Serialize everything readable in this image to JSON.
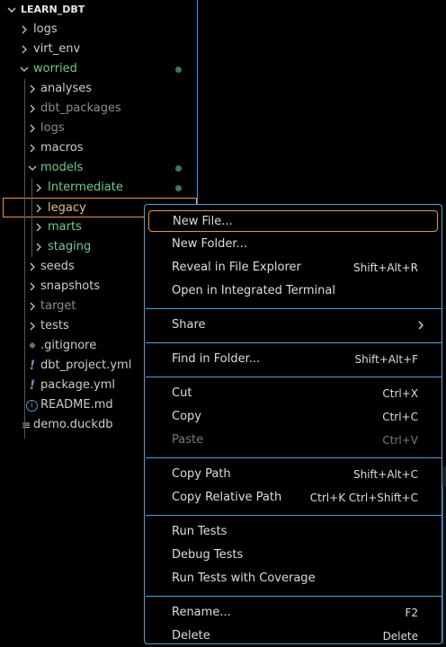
{
  "explorer": {
    "title": "LEARN_DBT",
    "tree": [
      {
        "label": "logs",
        "type": "folder",
        "depth": 0,
        "expanded": false,
        "color": "#cccccc",
        "modified": false
      },
      {
        "label": "virt_env",
        "type": "folder",
        "depth": 0,
        "expanded": false,
        "color": "#cccccc",
        "modified": false
      },
      {
        "label": "worried",
        "type": "folder",
        "depth": 0,
        "expanded": true,
        "color": "#73c991",
        "modified": true
      },
      {
        "label": "analyses",
        "type": "folder",
        "depth": 1,
        "expanded": false,
        "color": "#cccccc",
        "modified": false
      },
      {
        "label": "dbt_packages",
        "type": "folder",
        "depth": 1,
        "expanded": false,
        "color": "#8c8c8c",
        "modified": false
      },
      {
        "label": "logs",
        "type": "folder",
        "depth": 1,
        "expanded": false,
        "color": "#8c8c8c",
        "modified": false
      },
      {
        "label": "macros",
        "type": "folder",
        "depth": 1,
        "expanded": false,
        "color": "#cccccc",
        "modified": false
      },
      {
        "label": "models",
        "type": "folder",
        "depth": 1,
        "expanded": true,
        "color": "#73c991",
        "modified": true
      },
      {
        "label": "Intermediate",
        "type": "folder",
        "depth": 2,
        "expanded": false,
        "color": "#73c991",
        "modified": true
      },
      {
        "label": "legacy",
        "type": "folder",
        "depth": 2,
        "expanded": false,
        "color": "#e2c08d",
        "modified": false,
        "selected": true
      },
      {
        "label": "marts",
        "type": "folder",
        "depth": 2,
        "expanded": false,
        "color": "#73c991",
        "modified": false
      },
      {
        "label": "staging",
        "type": "folder",
        "depth": 2,
        "expanded": false,
        "color": "#73c991",
        "modified": false
      },
      {
        "label": "seeds",
        "type": "folder",
        "depth": 1,
        "expanded": false,
        "color": "#cccccc",
        "modified": false
      },
      {
        "label": "snapshots",
        "type": "folder",
        "depth": 1,
        "expanded": false,
        "color": "#cccccc",
        "modified": false
      },
      {
        "label": "target",
        "type": "folder",
        "depth": 1,
        "expanded": false,
        "color": "#8c8c8c",
        "modified": false
      },
      {
        "label": "tests",
        "type": "folder",
        "depth": 1,
        "expanded": false,
        "color": "#cccccc",
        "modified": false
      },
      {
        "label": ".gitignore",
        "type": "file",
        "icon": "git-icon",
        "depth": 1,
        "color": "#cccccc"
      },
      {
        "label": "dbt_project.yml",
        "type": "file",
        "icon": "yaml-icon",
        "depth": 1,
        "color": "#cccccc"
      },
      {
        "label": "package.yml",
        "type": "file",
        "icon": "yaml-icon",
        "depth": 1,
        "color": "#cccccc"
      },
      {
        "label": "README.md",
        "type": "file",
        "icon": "info-icon",
        "depth": 1,
        "color": "#cccccc"
      },
      {
        "label": "demo.duckdb",
        "type": "file",
        "icon": "text-file-icon",
        "depth": 0,
        "color": "#cccccc"
      }
    ]
  },
  "context_menu": {
    "groups": [
      [
        {
          "label": "New File...",
          "shortcut": "",
          "focused": true
        },
        {
          "label": "New Folder...",
          "shortcut": ""
        },
        {
          "label": "Reveal in File Explorer",
          "shortcut": "Shift+Alt+R"
        },
        {
          "label": "Open in Integrated Terminal",
          "shortcut": ""
        }
      ],
      [
        {
          "label": "Share",
          "shortcut": "",
          "submenu": true
        }
      ],
      [
        {
          "label": "Find in Folder...",
          "shortcut": "Shift+Alt+F"
        }
      ],
      [
        {
          "label": "Cut",
          "shortcut": "Ctrl+X"
        },
        {
          "label": "Copy",
          "shortcut": "Ctrl+C"
        },
        {
          "label": "Paste",
          "shortcut": "Ctrl+V",
          "disabled": true
        }
      ],
      [
        {
          "label": "Copy Path",
          "shortcut": "Shift+Alt+C"
        },
        {
          "label": "Copy Relative Path",
          "shortcut": "Ctrl+K Ctrl+Shift+C"
        }
      ],
      [
        {
          "label": "Run Tests",
          "shortcut": ""
        },
        {
          "label": "Debug Tests",
          "shortcut": ""
        },
        {
          "label": "Run Tests with Coverage",
          "shortcut": ""
        }
      ],
      [
        {
          "label": "Rename...",
          "shortcut": "F2"
        },
        {
          "label": "Delete",
          "shortcut": "Delete"
        }
      ]
    ]
  },
  "colors": {
    "accent_border": "#3794ff",
    "menu_border": "#4fa3d6",
    "focus_outline": "#e8954a",
    "modified_dot": "#3a7a52"
  }
}
